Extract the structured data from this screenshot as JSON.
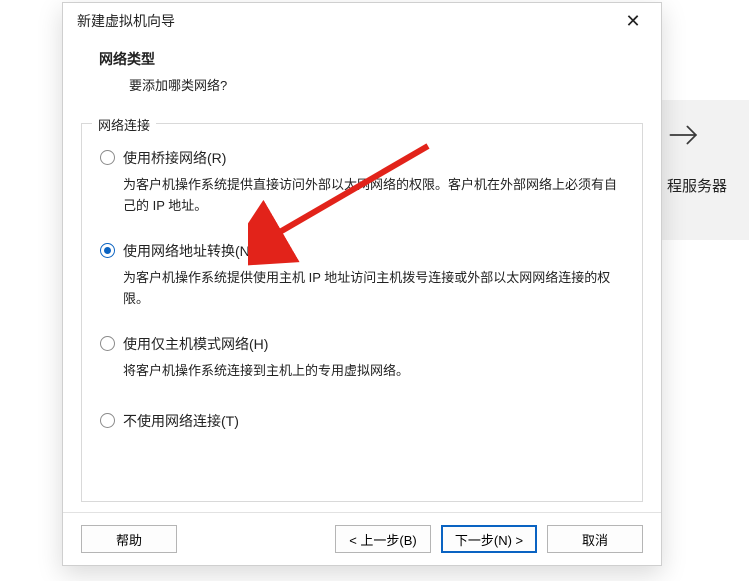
{
  "bg_panel": {
    "label": "程服务器"
  },
  "titlebar": {
    "title": "新建虚拟机向导",
    "close_glyph": "✕"
  },
  "header": {
    "heading": "网络类型",
    "sub": "要添加哪类网络?"
  },
  "group": {
    "legend": "网络连接",
    "options": [
      {
        "label": "使用桥接网络(R)",
        "desc": "为客户机操作系统提供直接访问外部以太网网络的权限。客户机在外部网络上必须有自己的 IP 地址。",
        "checked": false
      },
      {
        "label": "使用网络地址转换(NAT)(E)",
        "desc": "为客户机操作系统提供使用主机 IP 地址访问主机拨号连接或外部以太网网络连接的权限。",
        "checked": true
      },
      {
        "label": "使用仅主机模式网络(H)",
        "desc": "将客户机操作系统连接到主机上的专用虚拟网络。",
        "checked": false
      },
      {
        "label": "不使用网络连接(T)",
        "desc": "",
        "checked": false
      }
    ]
  },
  "footer": {
    "help": "帮助",
    "back": "< 上一步(B)",
    "next": "下一步(N) >",
    "cancel": "取消"
  }
}
